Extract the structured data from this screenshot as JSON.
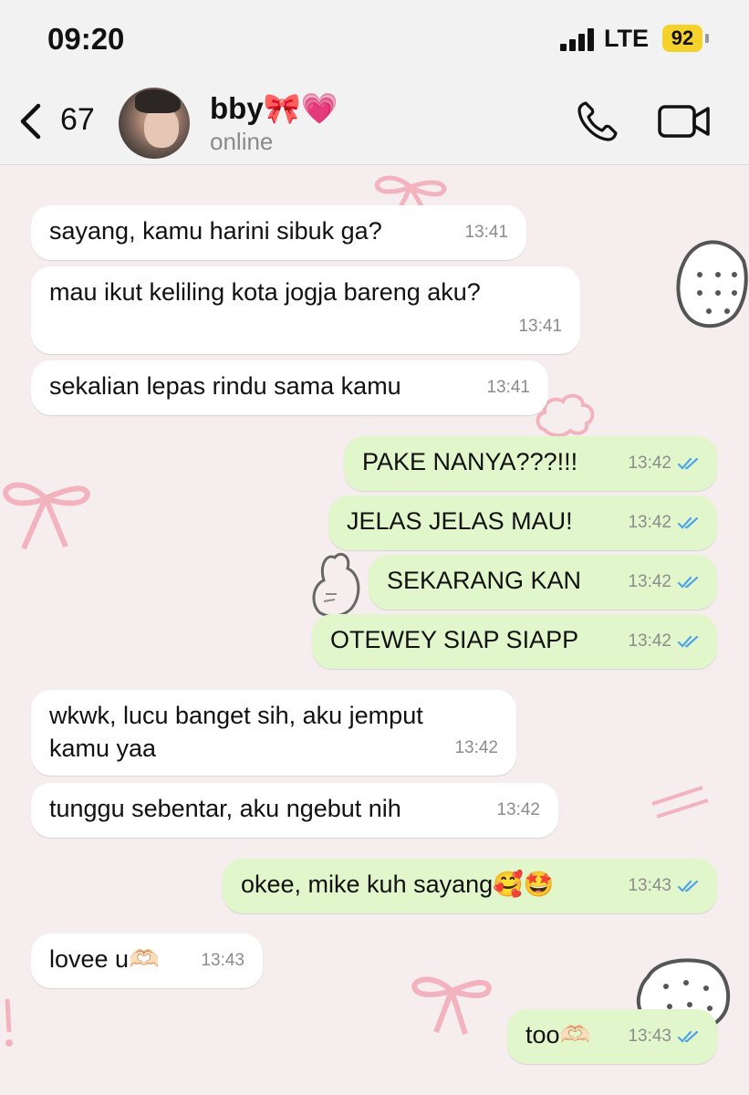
{
  "status_bar": {
    "time": "09:20",
    "network": "LTE",
    "battery": "92"
  },
  "header": {
    "back_count": "67",
    "contact_name": "bby🎀💗",
    "contact_status": "online"
  },
  "messages": [
    {
      "direction": "in",
      "text": "sayang, kamu harini sibuk ga?",
      "time": "13:41"
    },
    {
      "direction": "in",
      "text": "mau ikut keliling kota jogja bareng aku?",
      "time": "13:41"
    },
    {
      "direction": "in",
      "text": "sekalian lepas rindu sama kamu",
      "time": "13:41"
    },
    {
      "direction": "out",
      "text": "PAKE NANYA???!!!",
      "time": "13:42",
      "status": "read"
    },
    {
      "direction": "out",
      "text": "JELAS JELAS MAU!",
      "time": "13:42",
      "status": "read"
    },
    {
      "direction": "out",
      "text": "SEKARANG KAN",
      "time": "13:42",
      "status": "read"
    },
    {
      "direction": "out",
      "text": "OTEWEY SIAP SIAPP",
      "time": "13:42",
      "status": "read"
    },
    {
      "direction": "in",
      "text_line1": "wkwk, lucu banget sih, aku jemput",
      "text_line2": "kamu yaa",
      "time": "13:42"
    },
    {
      "direction": "in",
      "text": "tunggu sebentar, aku ngebut nih",
      "time": "13:42"
    },
    {
      "direction": "out",
      "text": "okee, mike kuh sayang🥰🤩",
      "time": "13:43",
      "status": "read"
    },
    {
      "direction": "in",
      "text": "lovee u🫶🏻",
      "time": "13:43"
    },
    {
      "direction": "out",
      "text": "too🫶🏻",
      "time": "13:43",
      "status": "read"
    }
  ],
  "colors": {
    "incoming_bubble": "#ffffff",
    "outgoing_bubble": "#e1f7cb",
    "read_tick": "#4fa3e8",
    "wallpaper": "#f6eeee",
    "bow": "#f2b3be"
  },
  "icons": [
    "back-chevron-icon",
    "phone-icon",
    "video-camera-icon",
    "double-check-icon",
    "signal-icon",
    "battery-icon"
  ]
}
